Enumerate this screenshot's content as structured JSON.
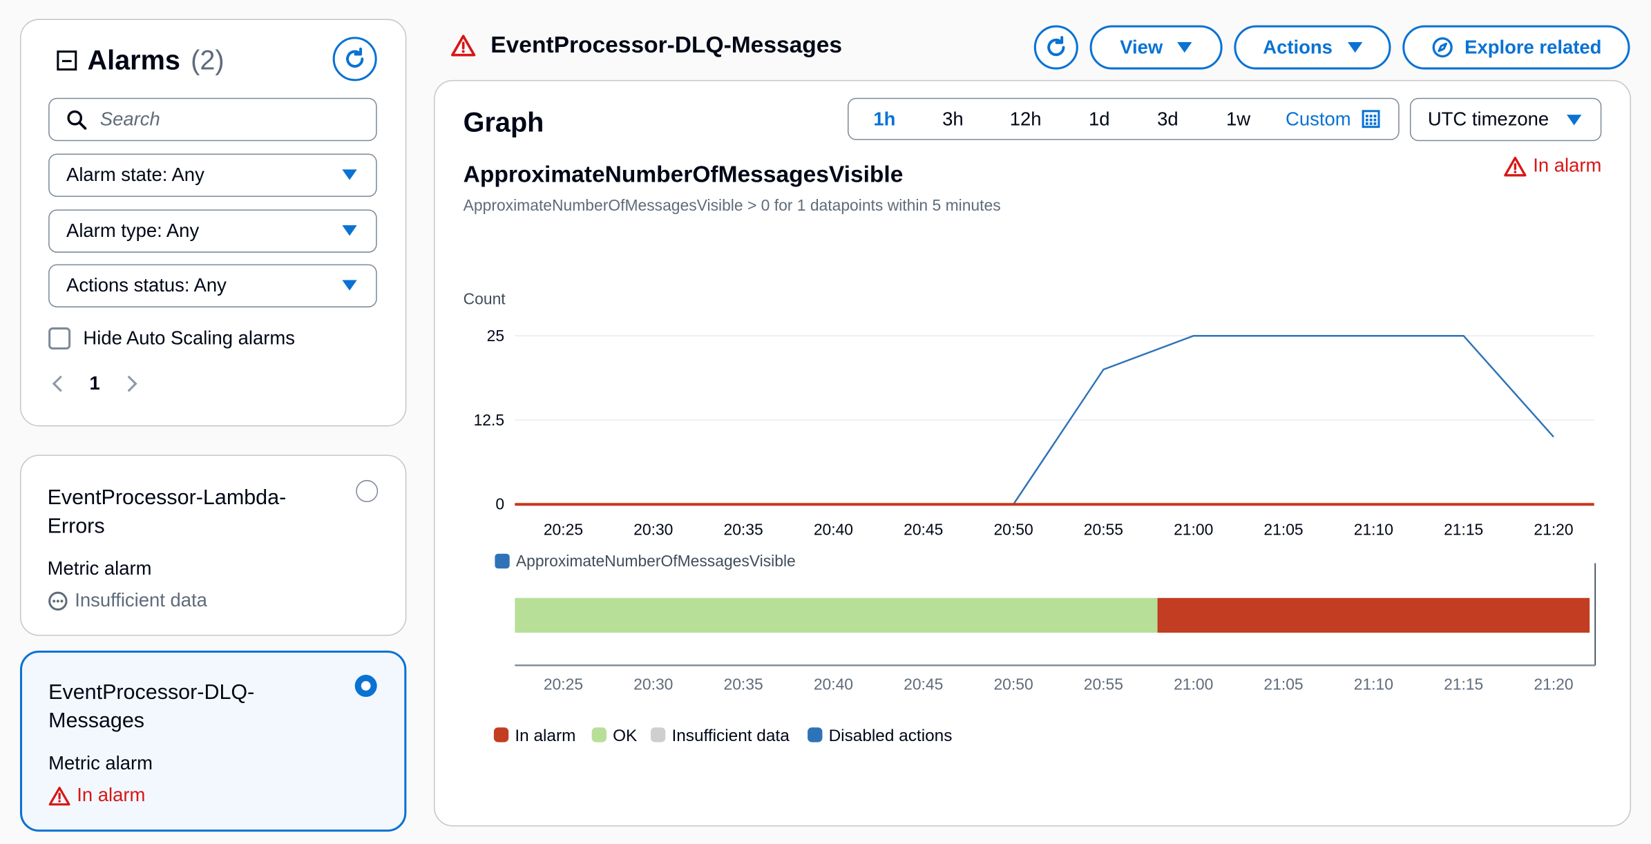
{
  "sidebar": {
    "title": "Alarms",
    "count": "(2)",
    "search_placeholder": "Search",
    "filters": [
      {
        "label": "Alarm state: Any"
      },
      {
        "label": "Alarm type: Any"
      },
      {
        "label": "Actions status: Any"
      }
    ],
    "hide_autoscaling_label": "Hide Auto Scaling alarms",
    "page": "1",
    "alarms": [
      {
        "name": "EventProcessor-Lambda-Errors",
        "type": "Metric alarm",
        "state": "Insufficient data",
        "selected": false
      },
      {
        "name": "EventProcessor-DLQ-Messages",
        "type": "Metric alarm",
        "state": "In alarm",
        "selected": true
      }
    ]
  },
  "header": {
    "title": "EventProcessor-DLQ-Messages",
    "view_label": "View",
    "actions_label": "Actions",
    "explore_label": "Explore related"
  },
  "graph": {
    "heading": "Graph",
    "ranges": [
      "1h",
      "3h",
      "12h",
      "1d",
      "3d",
      "1w"
    ],
    "active_range": "1h",
    "custom_label": "Custom",
    "timezone": "UTC timezone",
    "metric_title": "ApproximateNumberOfMessagesVisible",
    "metric_desc": "ApproximateNumberOfMessagesVisible > 0 for 1 datapoints within 5 minutes",
    "state_label": "In alarm"
  },
  "colors": {
    "accent": "#0972d3",
    "alarm": "#d91515",
    "line": "#2e73b8",
    "threshold": "#d13212",
    "ok": "#b7df98",
    "alarm_bar": "#c23d22",
    "insufficient": "#cfcfcf",
    "disabled": "#2e73b8"
  },
  "chart_data": {
    "type": "line",
    "ylabel": "Count",
    "y_ticks": [
      "0",
      "12.5",
      "25"
    ],
    "ylim": [
      0,
      25
    ],
    "x": [
      "20:25",
      "20:30",
      "20:35",
      "20:40",
      "20:45",
      "20:50",
      "20:55",
      "21:00",
      "21:05",
      "21:10",
      "21:15",
      "21:20"
    ],
    "series": [
      {
        "name": "ApproximateNumberOfMessagesVisible",
        "values": [
          0,
          0,
          0,
          0,
          0,
          0,
          20,
          25,
          25,
          25,
          25,
          10
        ]
      }
    ],
    "threshold": 0,
    "state_timeline": [
      {
        "state": "OK",
        "from": "20:22",
        "to": "20:58"
      },
      {
        "state": "In alarm",
        "from": "20:58",
        "to": "21:22"
      }
    ],
    "state_legend": [
      "In alarm",
      "OK",
      "Insufficient data",
      "Disabled actions"
    ]
  }
}
